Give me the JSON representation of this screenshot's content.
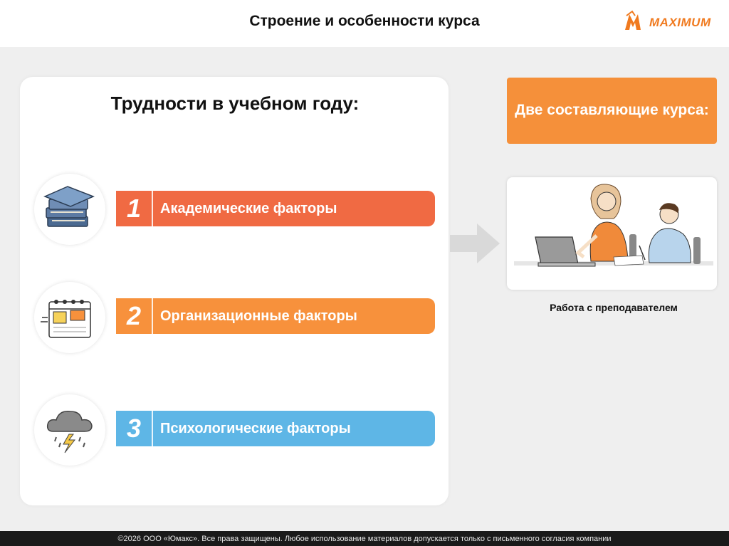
{
  "header": {
    "title": "Строение и особенности курса"
  },
  "logo": {
    "text": "MAXIMUM",
    "icon": "maximum-logo-icon",
    "color": "#f07a1f"
  },
  "card": {
    "title": "Трудности в учебном году:",
    "factors": [
      {
        "num": "1",
        "label": "Академические факторы",
        "color": "#f06a43",
        "icon": "books-icon"
      },
      {
        "num": "2",
        "label": "Организационные факторы",
        "color": "#f7913c",
        "icon": "calendar-icon"
      },
      {
        "num": "3",
        "label": "Психологические факторы",
        "color": "#5eb6e6",
        "icon": "storm-cloud-icon"
      }
    ]
  },
  "right": {
    "heading": "Две составляющие курса:",
    "caption": "Работа с преподавателем",
    "image_icon": "teacher-student-illustration-icon"
  },
  "footer": {
    "text": "©2026 ООО «Юмакс». Все права защищены. Любое использование материалов допускается только с письменного согласия компании"
  }
}
